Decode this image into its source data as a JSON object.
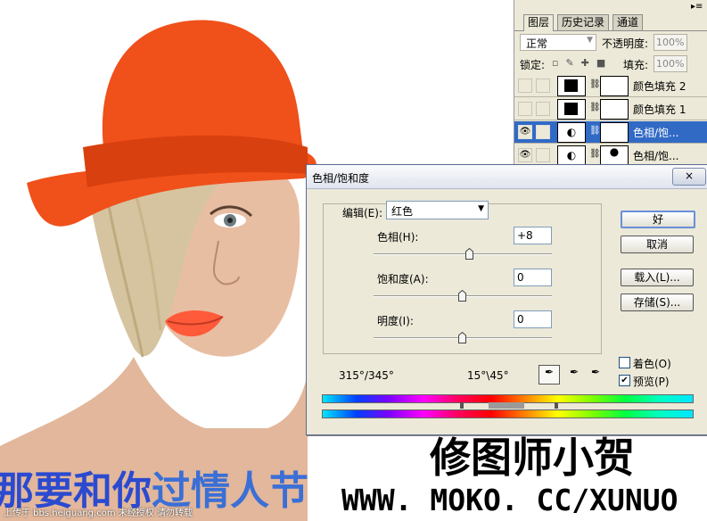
{
  "layers_panel": {
    "tabs": [
      "图层",
      "历史记录",
      "通道"
    ],
    "blend_mode": "正常",
    "opacity_label": "不透明度:",
    "opacity_value": "100%",
    "lock_label": "锁定:",
    "fill_label": "填充:",
    "fill_value": "100%",
    "layers": [
      {
        "name": "颜色填充 2",
        "selected": false,
        "visible": false
      },
      {
        "name": "颜色填充 1",
        "selected": false,
        "visible": false
      },
      {
        "name": "色相/饱...",
        "selected": true,
        "visible": true
      },
      {
        "name": "色相/饱...",
        "selected": false,
        "visible": true
      }
    ]
  },
  "dialog": {
    "title": "色相/饱和度",
    "edit_label": "编辑(E):",
    "edit_value": "红色",
    "hue_label": "色相(H):",
    "hue_value": "+8",
    "saturation_label": "饱和度(A):",
    "saturation_value": "0",
    "lightness_label": "明度(I):",
    "lightness_value": "0",
    "range_left": "315°/345°",
    "range_right": "15°\\45°",
    "buttons": {
      "ok": "好",
      "cancel": "取消",
      "load": "载入(L)...",
      "save": "存储(S)..."
    },
    "colorize_label": "着色(O)",
    "colorize_checked": false,
    "preview_label": "预览(P)",
    "preview_checked": true,
    "close_glyph": "×"
  },
  "watermark": {
    "author": "修图师小贺",
    "url": "WWW. MOKO. CC/XUNUO",
    "slogan_part1": "那要和你",
    "slogan_part2": "过情人节",
    "credit": "上传于 bbs.heiguang.com  未经授权  请勿转载"
  },
  "colors": {
    "hat": "#f0501a",
    "selection_blue": "#316ac5",
    "panel_bg": "#ece9d8"
  }
}
